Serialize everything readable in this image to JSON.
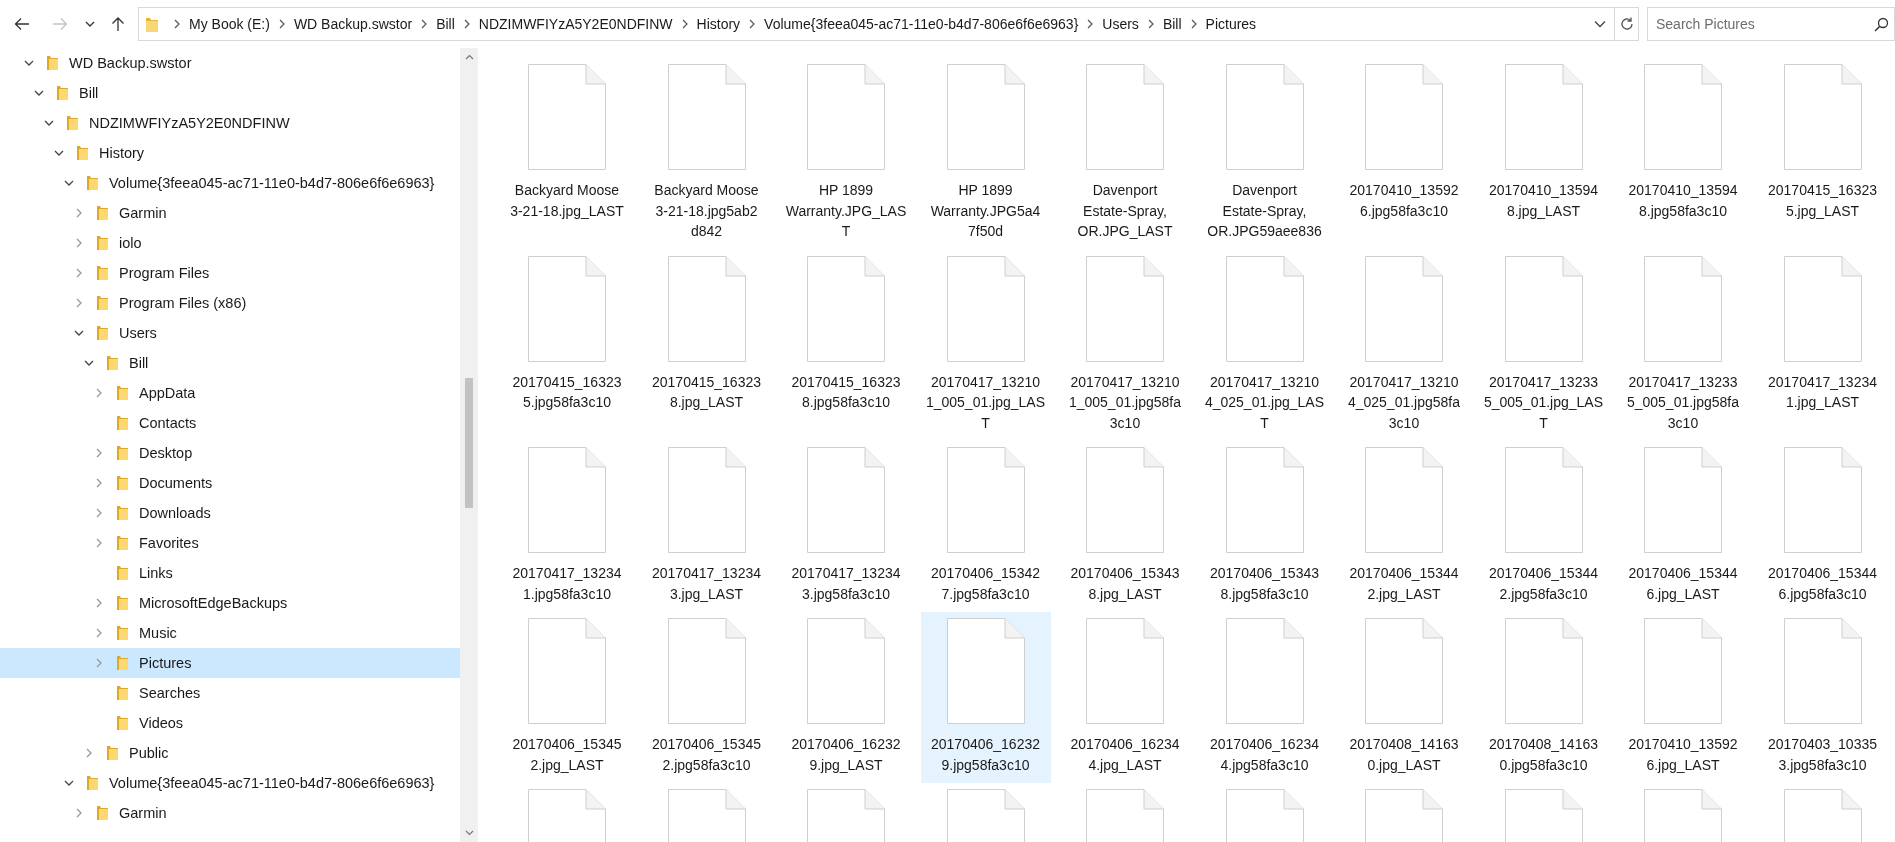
{
  "nav_buttons": [
    {
      "kind": "back",
      "disabled": false
    },
    {
      "kind": "forward",
      "disabled": true
    },
    {
      "kind": "recent",
      "disabled": false
    },
    {
      "kind": "up",
      "disabled": false
    }
  ],
  "address_bar": {
    "crumbs": [
      "My Book (E:)",
      "WD Backup.swstor",
      "Bill",
      "NDZIMWFIYzA5Y2E0NDFINW",
      "History",
      "Volume{3feea045-ac71-11e0-b4d7-806e6f6e6963}",
      "Users",
      "Bill",
      "Pictures"
    ]
  },
  "search": {
    "placeholder": "Search Pictures"
  },
  "tree": [
    {
      "label": "WD Backup.swstor",
      "expandable": true,
      "expanded": true,
      "selected": false,
      "children": [
        {
          "label": "Bill",
          "expandable": true,
          "expanded": true,
          "selected": false,
          "children": [
            {
              "label": "NDZIMWFIYzA5Y2E0NDFINW",
              "expandable": true,
              "expanded": true,
              "selected": false,
              "children": [
                {
                  "label": "History",
                  "expandable": true,
                  "expanded": true,
                  "selected": false,
                  "children": [
                    {
                      "label": "Volume{3feea045-ac71-11e0-b4d7-806e6f6e6963}",
                      "expandable": true,
                      "expanded": true,
                      "selected": false,
                      "children": [
                        {
                          "label": "Garmin",
                          "expandable": true,
                          "expanded": false,
                          "selected": false
                        },
                        {
                          "label": "iolo",
                          "expandable": true,
                          "expanded": false,
                          "selected": false
                        },
                        {
                          "label": "Program Files",
                          "expandable": true,
                          "expanded": false,
                          "selected": false
                        },
                        {
                          "label": "Program Files (x86)",
                          "expandable": true,
                          "expanded": false,
                          "selected": false
                        },
                        {
                          "label": "Users",
                          "expandable": true,
                          "expanded": true,
                          "selected": false,
                          "children": [
                            {
                              "label": "Bill",
                              "expandable": true,
                              "expanded": true,
                              "selected": false,
                              "children": [
                                {
                                  "label": "AppData",
                                  "expandable": true,
                                  "expanded": false,
                                  "selected": false
                                },
                                {
                                  "label": "Contacts",
                                  "expandable": false,
                                  "selected": false
                                },
                                {
                                  "label": "Desktop",
                                  "expandable": true,
                                  "expanded": false,
                                  "selected": false
                                },
                                {
                                  "label": "Documents",
                                  "expandable": true,
                                  "expanded": false,
                                  "selected": false
                                },
                                {
                                  "label": "Downloads",
                                  "expandable": true,
                                  "expanded": false,
                                  "selected": false
                                },
                                {
                                  "label": "Favorites",
                                  "expandable": true,
                                  "expanded": false,
                                  "selected": false
                                },
                                {
                                  "label": "Links",
                                  "expandable": false,
                                  "selected": false
                                },
                                {
                                  "label": "MicrosoftEdgeBackups",
                                  "expandable": true,
                                  "expanded": false,
                                  "selected": false
                                },
                                {
                                  "label": "Music",
                                  "expandable": true,
                                  "expanded": false,
                                  "selected": false
                                },
                                {
                                  "label": "Pictures",
                                  "expandable": true,
                                  "expanded": false,
                                  "selected": true
                                },
                                {
                                  "label": "Searches",
                                  "expandable": false,
                                  "selected": false
                                },
                                {
                                  "label": "Videos",
                                  "expandable": false,
                                  "selected": false
                                }
                              ]
                            },
                            {
                              "label": "Public",
                              "expandable": true,
                              "expanded": false,
                              "selected": false
                            }
                          ]
                        }
                      ]
                    },
                    {
                      "label": "Volume{3feea045-ac71-11e0-b4d7-806e6f6e6963}",
                      "expandable": true,
                      "expanded": true,
                      "selected": false,
                      "children": [
                        {
                          "label": "Garmin",
                          "expandable": true,
                          "expanded": false,
                          "selected": false
                        }
                      ]
                    }
                  ]
                }
              ]
            }
          ]
        }
      ]
    }
  ],
  "files": [
    {
      "lines": [
        "Backyard Moose",
        "3-21-18.jpg_LAST"
      ],
      "selected": false
    },
    {
      "lines": [
        "Backyard Moose",
        "3-21-18.jpg5ab2",
        "d842"
      ],
      "selected": false
    },
    {
      "lines": [
        "HP 1899",
        "Warranty.JPG_LAS",
        "T"
      ],
      "selected": false
    },
    {
      "lines": [
        "HP 1899",
        "Warranty.JPG5a4",
        "7f50d"
      ],
      "selected": false
    },
    {
      "lines": [
        "Davenport",
        "Estate-Spray,",
        "OR.JPG_LAST"
      ],
      "selected": false
    },
    {
      "lines": [
        "Davenport",
        "Estate-Spray,",
        "OR.JPG59aee836"
      ],
      "selected": false
    },
    {
      "lines": [
        "20170410_13592",
        "6.jpg58fa3c10"
      ],
      "selected": false
    },
    {
      "lines": [
        "20170410_13594",
        "8.jpg_LAST"
      ],
      "selected": false
    },
    {
      "lines": [
        "20170410_13594",
        "8.jpg58fa3c10"
      ],
      "selected": false
    },
    {
      "lines": [
        "20170415_16323",
        "5.jpg_LAST"
      ],
      "selected": false
    },
    {
      "lines": [
        "20170415_16323",
        "5.jpg58fa3c10"
      ],
      "selected": false
    },
    {
      "lines": [
        "20170415_16323",
        "8.jpg_LAST"
      ],
      "selected": false
    },
    {
      "lines": [
        "20170415_16323",
        "8.jpg58fa3c10"
      ],
      "selected": false
    },
    {
      "lines": [
        "20170417_13210",
        "1_005_01.jpg_LAS",
        "T"
      ],
      "selected": false
    },
    {
      "lines": [
        "20170417_13210",
        "1_005_01.jpg58fa",
        "3c10"
      ],
      "selected": false
    },
    {
      "lines": [
        "20170417_13210",
        "4_025_01.jpg_LAS",
        "T"
      ],
      "selected": false
    },
    {
      "lines": [
        "20170417_13210",
        "4_025_01.jpg58fa",
        "3c10"
      ],
      "selected": false
    },
    {
      "lines": [
        "20170417_13233",
        "5_005_01.jpg_LAS",
        "T"
      ],
      "selected": false
    },
    {
      "lines": [
        "20170417_13233",
        "5_005_01.jpg58fa",
        "3c10"
      ],
      "selected": false
    },
    {
      "lines": [
        "20170417_13234",
        "1.jpg_LAST"
      ],
      "selected": false
    },
    {
      "lines": [
        "20170417_13234",
        "1.jpg58fa3c10"
      ],
      "selected": false
    },
    {
      "lines": [
        "20170417_13234",
        "3.jpg_LAST"
      ],
      "selected": false
    },
    {
      "lines": [
        "20170417_13234",
        "3.jpg58fa3c10"
      ],
      "selected": false
    },
    {
      "lines": [
        "20170406_15342",
        "7.jpg58fa3c10"
      ],
      "selected": false
    },
    {
      "lines": [
        "20170406_15343",
        "8.jpg_LAST"
      ],
      "selected": false
    },
    {
      "lines": [
        "20170406_15343",
        "8.jpg58fa3c10"
      ],
      "selected": false
    },
    {
      "lines": [
        "20170406_15344",
        "2.jpg_LAST"
      ],
      "selected": false
    },
    {
      "lines": [
        "20170406_15344",
        "2.jpg58fa3c10"
      ],
      "selected": false
    },
    {
      "lines": [
        "20170406_15344",
        "6.jpg_LAST"
      ],
      "selected": false
    },
    {
      "lines": [
        "20170406_15344",
        "6.jpg58fa3c10"
      ],
      "selected": false
    },
    {
      "lines": [
        "20170406_15345",
        "2.jpg_LAST"
      ],
      "selected": false
    },
    {
      "lines": [
        "20170406_15345",
        "2.jpg58fa3c10"
      ],
      "selected": false
    },
    {
      "lines": [
        "20170406_16232",
        "9.jpg_LAST"
      ],
      "selected": false
    },
    {
      "lines": [
        "20170406_16232",
        "9.jpg58fa3c10"
      ],
      "selected": true
    },
    {
      "lines": [
        "20170406_16234",
        "4.jpg_LAST"
      ],
      "selected": false
    },
    {
      "lines": [
        "20170406_16234",
        "4.jpg58fa3c10"
      ],
      "selected": false
    },
    {
      "lines": [
        "20170408_14163",
        "0.jpg_LAST"
      ],
      "selected": false
    },
    {
      "lines": [
        "20170408_14163",
        "0.jpg58fa3c10"
      ],
      "selected": false
    },
    {
      "lines": [
        "20170410_13592",
        "6.jpg_LAST"
      ],
      "selected": false
    },
    {
      "lines": [
        "20170403_10335",
        "3.jpg58fa3c10"
      ],
      "selected": false
    },
    {
      "selected": false
    },
    {
      "selected": false
    },
    {
      "selected": false
    },
    {
      "selected": false
    },
    {
      "selected": false
    },
    {
      "selected": false
    },
    {
      "selected": false
    },
    {
      "selected": false
    },
    {
      "selected": false
    },
    {
      "selected": false
    }
  ]
}
